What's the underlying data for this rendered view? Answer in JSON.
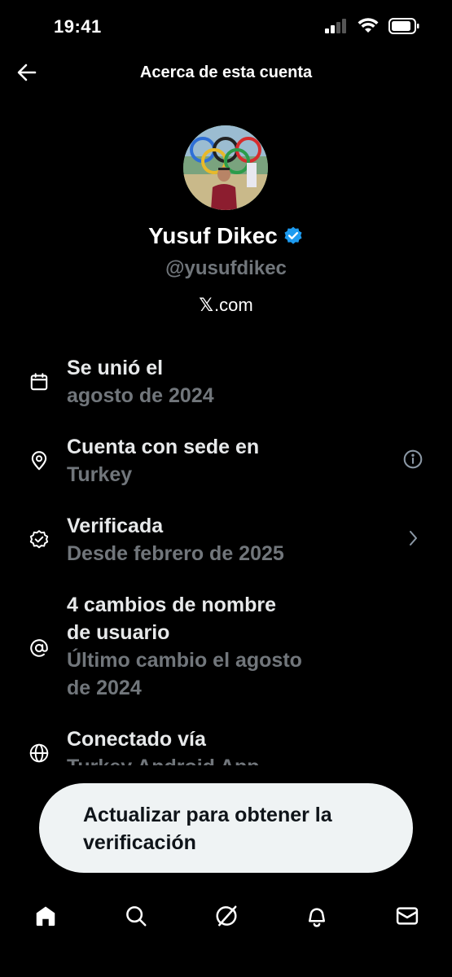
{
  "status": {
    "time": "19:41"
  },
  "header": {
    "title": "Acerca de esta cuenta"
  },
  "profile": {
    "name": "Yusuf Dikec",
    "handle": "@yusufdikec",
    "site_logo": "𝕏",
    "site_text": ".com"
  },
  "info": [
    {
      "icon": "calendar-icon",
      "title_lines": [
        "Se unió el"
      ],
      "sub_lines": [
        "agosto de 2024"
      ]
    },
    {
      "icon": "location-pin-icon",
      "title_lines": [
        "Cuenta con sede en"
      ],
      "sub_lines": [
        "Turkey"
      ],
      "trailing": "info-icon"
    },
    {
      "icon": "verified-badge-icon",
      "title_lines": [
        "Verificada"
      ],
      "sub_lines": [
        "Desde febrero de 2025"
      ],
      "trailing": "chevron-right-icon"
    },
    {
      "icon": "at-sign-icon",
      "title_lines": [
        "4 cambios de nombre",
        "de usuario"
      ],
      "sub_lines": [
        "Último cambio el agosto",
        "de 2024"
      ]
    },
    {
      "icon": "globe-icon",
      "title_lines": [
        "Conectado vía"
      ],
      "sub_lines": [
        "Turkey Android App"
      ]
    }
  ],
  "cta": {
    "label": "Actualizar para obtener la verificación"
  },
  "tabs": [
    "home-icon",
    "search-icon",
    "grok-icon",
    "bell-icon",
    "mail-icon"
  ],
  "colors": {
    "background": "#000000",
    "muted": "#71767b",
    "verified": "#1d9bf0",
    "cta_bg": "#eff3f4"
  }
}
